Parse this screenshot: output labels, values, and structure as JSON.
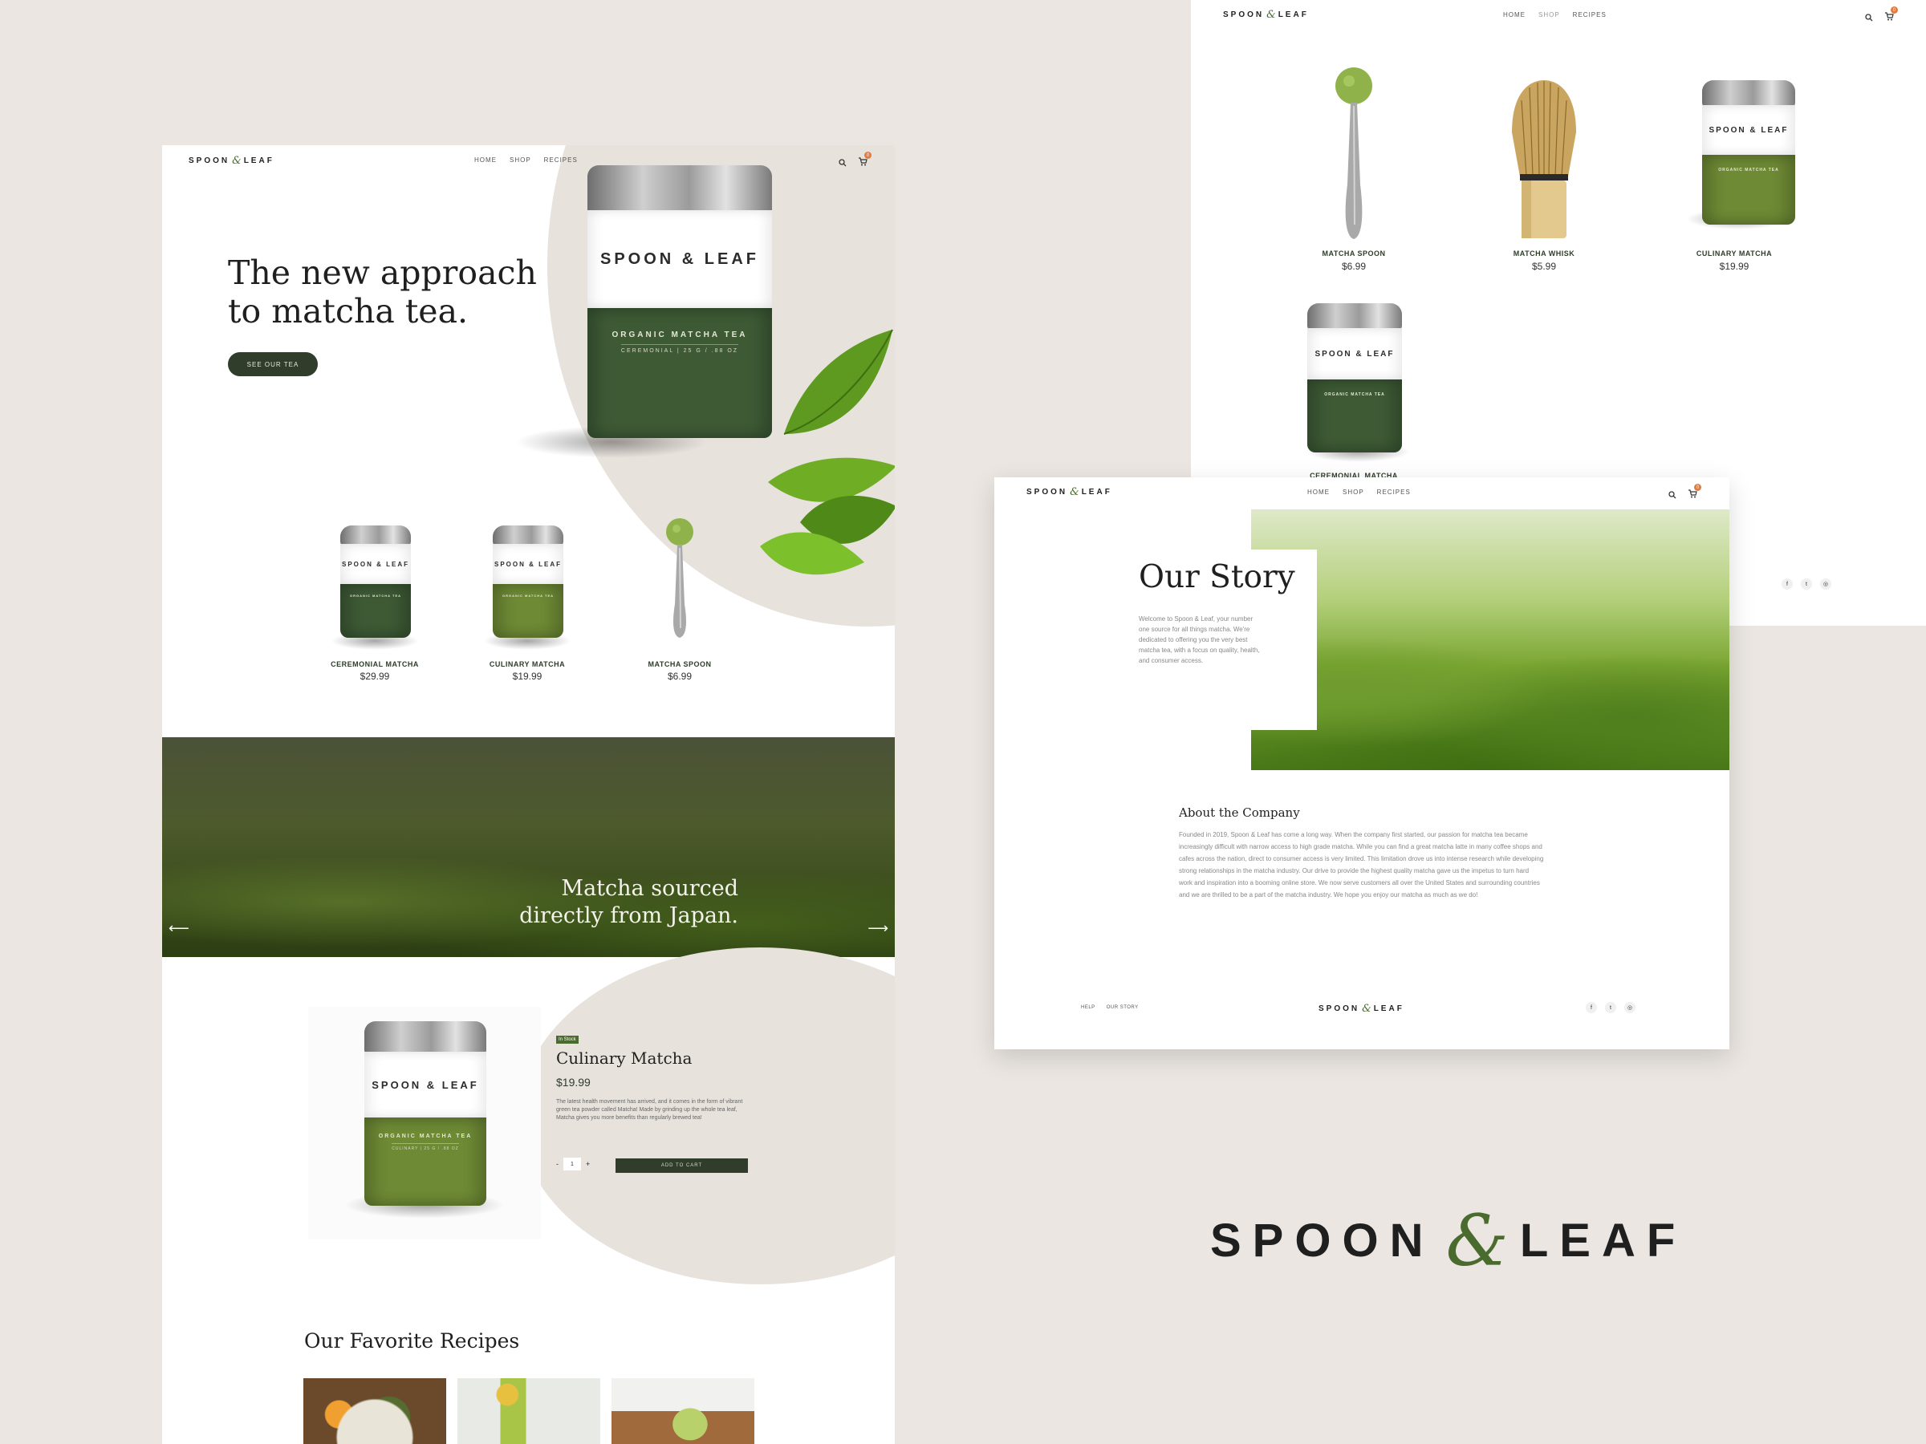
{
  "brand": {
    "word1": "SPOON",
    "amp": "&",
    "word2": "LEAF"
  },
  "nav": {
    "home": "HOME",
    "shop": "SHOP",
    "recipes": "RECIPES",
    "cart_count": "0"
  },
  "tin_labels": {
    "brand_line": "SPOON & LEAF",
    "product": "ORGANIC MATCHA TEA",
    "ceremonial": "CEREMONIAL  |  25 G / .88 OZ",
    "culinary": "CULINARY  |  25 G / .88 OZ"
  },
  "home": {
    "hero_title_line1": "The new approach",
    "hero_title_line2": "to matcha tea.",
    "hero_button": "SEE OUR TEA",
    "products": [
      {
        "name": "CEREMONIAL MATCHA",
        "price": "$29.99"
      },
      {
        "name": "CULINARY MATCHA",
        "price": "$19.99"
      },
      {
        "name": "MATCHA SPOON",
        "price": "$6.99"
      }
    ],
    "banner_line1": "Matcha sourced",
    "banner_line2": "directly from Japan.",
    "arrow_left": "⟵",
    "arrow_right": "⟶",
    "featured": {
      "badge": "In Stock",
      "title": "Culinary Matcha",
      "price": "$19.99",
      "description": "The latest health movement has arrived, and it comes in the form of vibrant green tea powder called Matcha! Made by grinding up the whole tea leaf, Matcha gives you more benefits than regularly brewed tea!",
      "qty_minus": "-",
      "qty_value": "1",
      "qty_plus": "+",
      "add_to_cart": "ADD TO CART"
    },
    "recipes_title": "Our Favorite Recipes"
  },
  "shop": {
    "products": [
      {
        "name": "MATCHA SPOON",
        "price": "$6.99"
      },
      {
        "name": "MATCHA WHISK",
        "price": "$5.99"
      },
      {
        "name": "CULINARY MATCHA",
        "price": "$19.99"
      },
      {
        "name": "CEREMONIAL MATCHA",
        "price": ""
      }
    ]
  },
  "story": {
    "title": "Our Story",
    "intro": "Welcome to Spoon & Leaf, your number one source for all things matcha. We're dedicated to offering you the very best matcha tea, with a focus on quality, health, and consumer access.",
    "about_title": "About the Company",
    "about_text": "Founded in 2019, Spoon & Leaf has come a long way. When the company first started, our passion for matcha tea became increasingly difficult with narrow access to high grade matcha. While you can find a great matcha latte in many coffee shops and cafes across the nation, direct to consumer access is very limited. This limitation drove us into intense research while developing strong relationships in the matcha industry. Our drive to provide the highest quality matcha gave us the impetus to turn hard work and inspiration into a booming online store. We now serve customers all over the United States and surrounding countries and we are thrilled to be a part of the matcha industry. We hope you enjoy our matcha as much as we do!",
    "footer_help": "HELP",
    "footer_story": "OUR STORY"
  },
  "social": {
    "facebook": "f",
    "twitter": "t",
    "instagram": "◎"
  },
  "colors": {
    "bg": "#ebe6e1",
    "dark_green": "#2f3d2a",
    "tin_dark": "#3d5a35",
    "tin_light": "#6e8a35",
    "accent": "#e07a3f"
  }
}
